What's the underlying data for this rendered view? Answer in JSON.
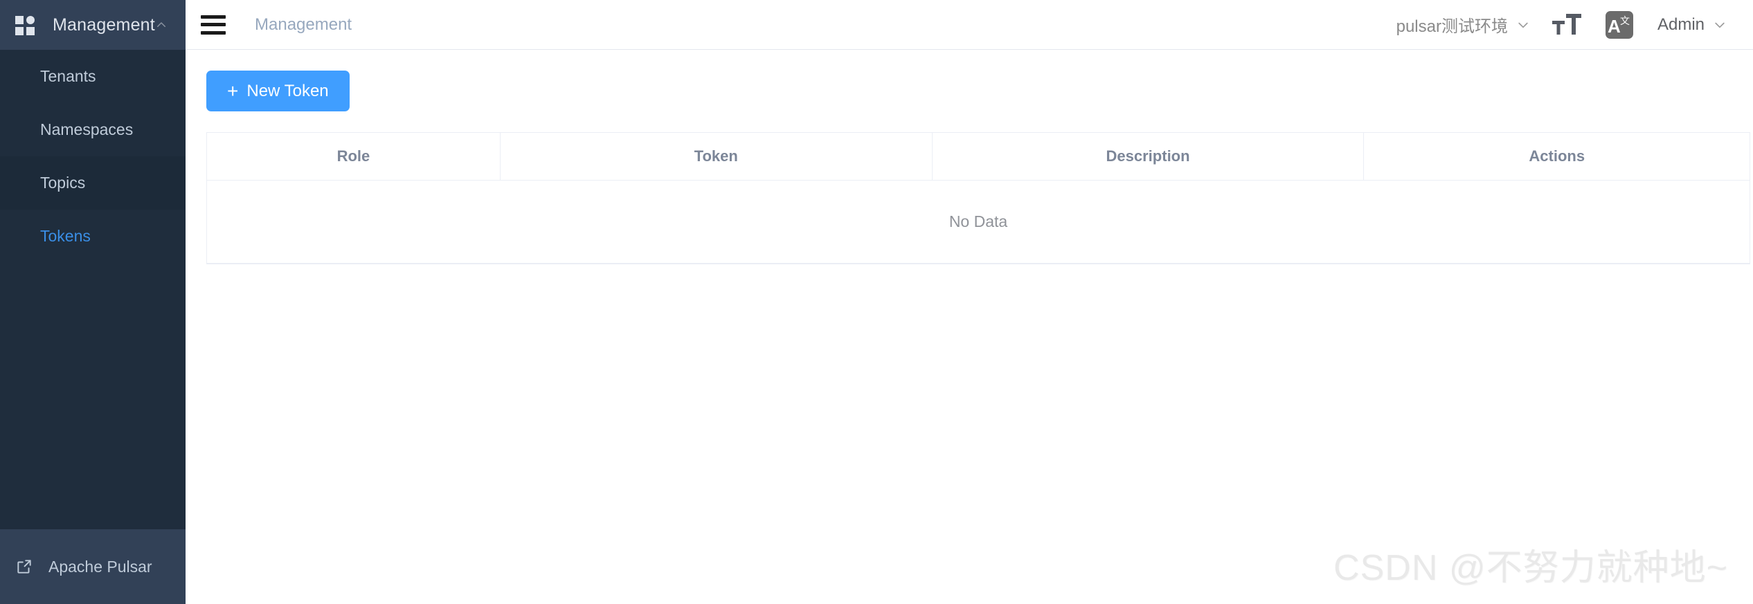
{
  "sidebar": {
    "logo": {
      "icon": "grid-icon",
      "title": "Management",
      "collapse_icon": "chevron-up-icon"
    },
    "items": [
      {
        "label": "Tenants",
        "active": false
      },
      {
        "label": "Namespaces",
        "active": false
      },
      {
        "label": "Topics",
        "active": false
      },
      {
        "label": "Tokens",
        "active": true
      }
    ],
    "footer": {
      "label": "Apache Pulsar",
      "icon": "external-link-icon"
    },
    "colors": {
      "background": "#1f2d3d",
      "header_background": "#324157",
      "text": "#bfcbd9",
      "active_text": "#3a8ee6"
    }
  },
  "navbar": {
    "hamburger_icon": "hamburger-menu-icon",
    "breadcrumb": "Management",
    "environment": {
      "label": "pulsar测试环境",
      "caret_icon": "chevron-down-icon"
    },
    "font_size_icon": "font-size-icon",
    "translate_icon": "translate-icon",
    "user": {
      "label": "Admin",
      "caret_icon": "chevron-down-icon"
    }
  },
  "content": {
    "new_token_button": {
      "label": "New Token",
      "plus": "+",
      "color": "#409eff"
    },
    "table": {
      "headers": [
        "Role",
        "Token",
        "Description",
        "Actions"
      ],
      "rows": [],
      "empty_text": "No Data"
    }
  },
  "watermark": "CSDN @不努力就种地~"
}
